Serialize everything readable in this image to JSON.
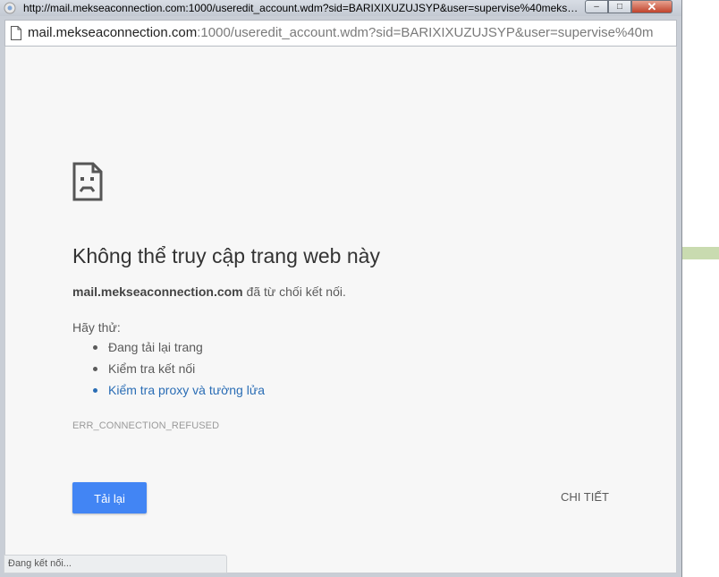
{
  "window": {
    "title": "http://mail.mekseaconnection.com:1000/useredit_account.wdm?sid=BARIXIXUZUJSYP&user=supervise%40mekseac...",
    "controls": {
      "minimize": "‒",
      "maximize": "□",
      "close": "✕"
    }
  },
  "addressbar": {
    "host": "mail.mekseaconnection.com",
    "path": ":1000/useredit_account.wdm?sid=BARIXIXUZUJSYP&user=supervise%40m",
    "icon": "page-icon"
  },
  "error": {
    "icon": "sad-page-icon",
    "heading": "Không thể truy cập trang web này",
    "host_bold": "mail.mekseaconnection.com",
    "description_suffix": " đã từ chối kết nối.",
    "try_label": "Hãy thử:",
    "suggestions": [
      "Đang tải lại trang",
      "Kiểm tra kết nối",
      "Kiểm tra proxy và tường lửa"
    ],
    "error_code": "ERR_CONNECTION_REFUSED",
    "reload_label": "Tải lại",
    "details_label": "CHI TIẾT"
  },
  "status": {
    "text": "Đang kết nối..."
  },
  "colors": {
    "accent": "#4285f4",
    "link": "#2a6db5",
    "content_bg": "#f7f7f7"
  }
}
